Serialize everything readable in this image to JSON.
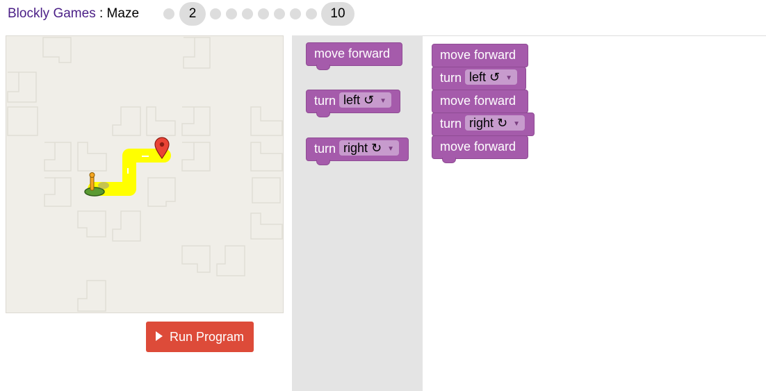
{
  "header": {
    "app_name": "Blockly Games",
    "separator": " : ",
    "game_name": "Maze",
    "levels": [
      "1",
      "2",
      "3",
      "4",
      "5",
      "6",
      "7",
      "8",
      "9",
      "10"
    ],
    "current_level": "2",
    "last_level": "10"
  },
  "run_button": {
    "label": "Run Program"
  },
  "toolbox": {
    "move_forward": "move forward",
    "turn_label": "turn",
    "turn_left_option": "left ↺",
    "turn_right_option": "right ↻"
  },
  "workspace": {
    "blocks": [
      {
        "type": "move",
        "label": "move forward"
      },
      {
        "type": "turn",
        "label": "turn",
        "option": "left ↺"
      },
      {
        "type": "move",
        "label": "move forward"
      },
      {
        "type": "turn",
        "label": "turn",
        "option": "right ↻"
      },
      {
        "type": "move",
        "label": "move forward"
      }
    ]
  },
  "colors": {
    "block": "#a55bab",
    "dropdown": "#c79bcd",
    "run": "#dd4b39",
    "path": "#ffff00"
  }
}
